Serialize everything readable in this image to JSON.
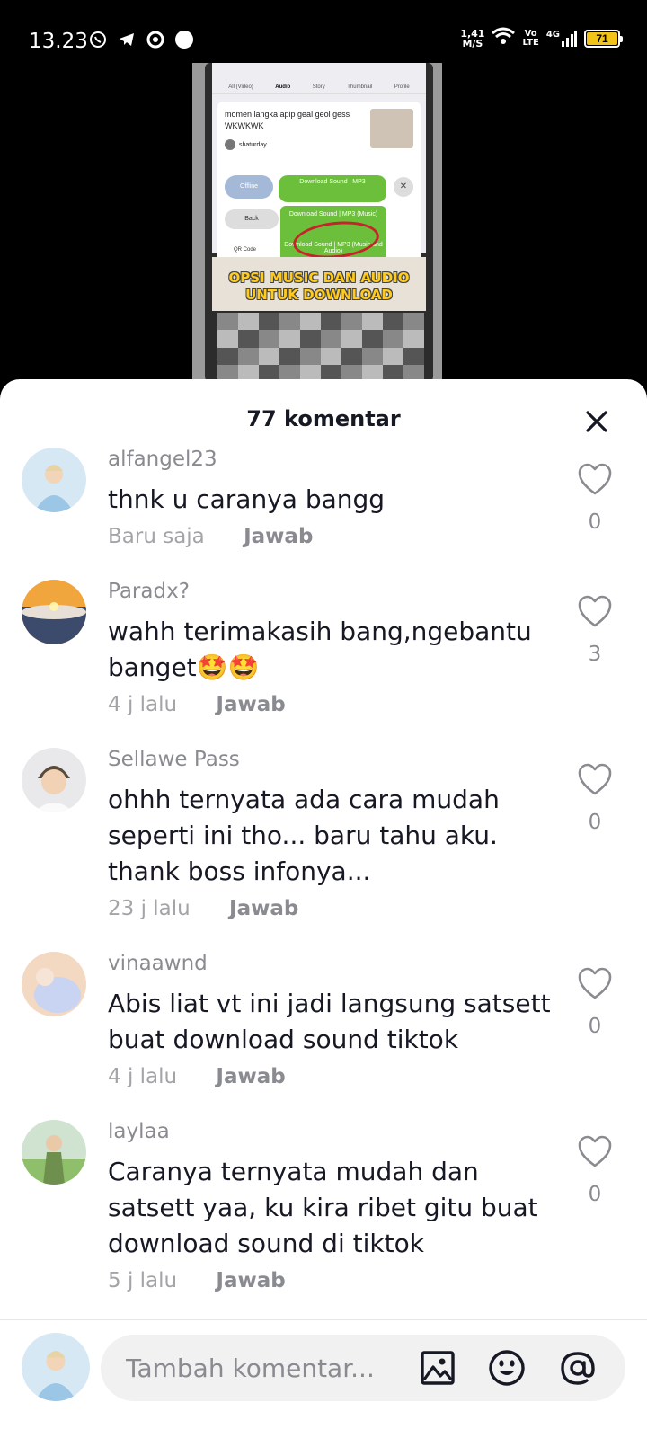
{
  "status_bar": {
    "time": "13.23",
    "net_speed_value": "1,41",
    "net_speed_unit": "M/S",
    "volte_top": "Vo",
    "volte_bottom": "LTE",
    "network": "4G",
    "battery": "71"
  },
  "video": {
    "tabs": [
      "All (Video)",
      "Audio",
      "Story",
      "Thumbnail",
      "Profile"
    ],
    "card_title": "momen langka apip geal geol gess WKWKWK",
    "card_user": "shaturday",
    "offline_label": "Offline",
    "download_label": "Download Sound | MP3",
    "back_label": "Back",
    "dropdown_item_1": "Download Sound | MP3 (Music)",
    "dropdown_item_2": "Download Sound | MP3 (Music and Audio)",
    "qr_label": "QR Code",
    "banner_line_1": "OPSI MUSIC DAN AUDIO",
    "banner_line_2": "UNTUK DOWNLOAD"
  },
  "sheet": {
    "title": "77 komentar",
    "comments": [
      {
        "user": "alfangel23",
        "text": "thnk u caranya bangg",
        "time": "Baru saja",
        "reply": "Jawab",
        "likes": "0",
        "avatar_colors": [
          "#d7e8f5",
          "#9cc6e6"
        ]
      },
      {
        "user": "Paradx?",
        "text": "wahh terimakasih bang,ngebantu banget🤩🤩",
        "time": "4 j lalu",
        "reply": "Jawab",
        "likes": "3",
        "avatar_colors": [
          "#f0a63c",
          "#3c4a6b"
        ]
      },
      {
        "user": "Sellawe Pass",
        "text": "ohhh ternyata ada cara mudah seperti ini tho... baru tahu aku. thank boss infonya...",
        "time": "23 j lalu",
        "reply": "Jawab",
        "likes": "0",
        "avatar_colors": [
          "#e9e9ec",
          "#5a4a3a"
        ]
      },
      {
        "user": "vinaawnd",
        "text": "Abis liat vt ini jadi langsung satsett buat download sound tiktok",
        "time": "4 j lalu",
        "reply": "Jawab",
        "likes": "0",
        "avatar_colors": [
          "#f3d9c1",
          "#c9d3f2"
        ]
      },
      {
        "user": "laylaa",
        "text": "Caranya ternyata mudah dan satsett yaa, ku kira ribet gitu buat download sound di tiktok",
        "time": "5 j lalu",
        "reply": "Jawab",
        "likes": "0",
        "avatar_colors": [
          "#8fbf6a",
          "#6f8f4f"
        ]
      }
    ]
  },
  "footer": {
    "placeholder": "Tambah komentar...",
    "icons": [
      "image-icon",
      "emoji-icon",
      "mention-icon"
    ]
  }
}
